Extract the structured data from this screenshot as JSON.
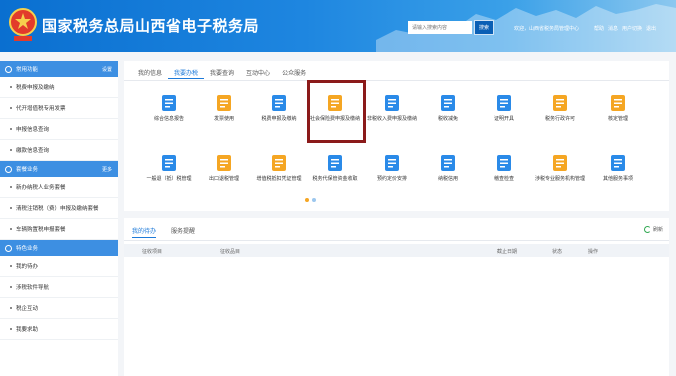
{
  "header": {
    "title": "国家税务总局山西省电子税务局",
    "search_placeholder": "请输入搜索内容",
    "search_button": "搜索",
    "welcome": "欢迎，山西省税务局管理中心",
    "links": [
      "帮助",
      "消息",
      "用户切换",
      "退出"
    ]
  },
  "sidebar": {
    "sections": [
      {
        "title": "常用功能",
        "right": "设置",
        "items": [
          "税费申报及缴纳",
          "代开增值税专用发票",
          "申报信息查询",
          "缴款信息查询"
        ]
      },
      {
        "title": "套餐业务",
        "right": "更多",
        "items": [
          "新办纳税人业务套餐",
          "清税注销税（费）申报及缴纳套餐",
          "车辆购置税申报套餐"
        ]
      },
      {
        "title": "特色业务",
        "right": "",
        "items": [
          "我的待办",
          "涉税软件导航",
          "税企互动",
          "我要求助"
        ]
      }
    ]
  },
  "tabs": [
    "我的信息",
    "我要办税",
    "我要查询",
    "互动中心",
    "公众服务"
  ],
  "active_tab": 1,
  "tiles": [
    {
      "label": "综合信息报告",
      "icon": "document-icon",
      "color": "#2a8ae8"
    },
    {
      "label": "发票使用",
      "icon": "invoice-icon",
      "color": "#f5a623"
    },
    {
      "label": "税费申报及缴纳",
      "icon": "tax-return-icon",
      "color": "#2a8ae8"
    },
    {
      "label": "社会保险费申报及缴纳",
      "icon": "calendar-icon",
      "color": "#f5a623"
    },
    {
      "label": "非税收入费申报及缴纳",
      "icon": "ledger-icon",
      "color": "#2a8ae8"
    },
    {
      "label": "税收减免",
      "icon": "copy-icon",
      "color": "#2a8ae8"
    },
    {
      "label": "证明开具",
      "icon": "certificate-icon",
      "color": "#2a8ae8"
    },
    {
      "label": "税务行政许可",
      "icon": "shield-icon",
      "color": "#f5a623"
    },
    {
      "label": "核定管理",
      "icon": "pie-chart-icon",
      "color": "#f5a623"
    },
    {
      "label": "一般退（抵）税管理",
      "icon": "refund-icon",
      "color": "#2a8ae8"
    },
    {
      "label": "出口退税管理",
      "icon": "export-icon",
      "color": "#f5a623"
    },
    {
      "label": "增值税抵扣凭证管理",
      "icon": "voucher-icon",
      "color": "#f5a623"
    },
    {
      "label": "税务代保管资金收取",
      "icon": "wallet-icon",
      "color": "#2a8ae8"
    },
    {
      "label": "预约定价安排",
      "icon": "arrange-icon",
      "color": "#2a8ae8"
    },
    {
      "label": "纳税信用",
      "icon": "check-icon",
      "color": "#2a8ae8"
    },
    {
      "label": "稽查检查",
      "icon": "clipboard-icon",
      "color": "#2a8ae8"
    },
    {
      "label": "涉税专业服务机构管理",
      "icon": "agency-icon",
      "color": "#f5a623"
    },
    {
      "label": "其他服务事项",
      "icon": "search-doc-icon",
      "color": "#2a8ae8"
    }
  ],
  "bottom": {
    "tab_active": "我的待办",
    "tab2": "服务提醒",
    "refresh": "刷新",
    "columns": [
      "征收项目",
      "征收品目",
      "截止日期",
      "状态",
      "操作"
    ]
  },
  "colors": {
    "header_blue": "#0a6fd0",
    "sidebar_head": "#3d8fe2",
    "accent": "#1d7ad9",
    "highlight": "#8b1a1a"
  }
}
